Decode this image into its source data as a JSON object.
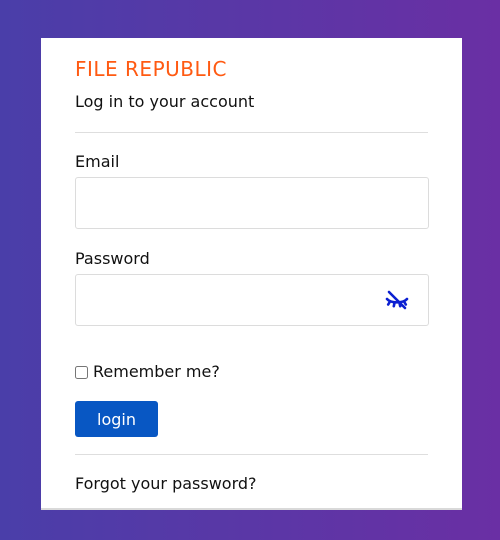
{
  "brand": {
    "name": "FILE REPUBLIC",
    "color": "#ff5a12"
  },
  "form": {
    "subtitle": "Log in to your account",
    "email": {
      "label": "Email",
      "value": "",
      "placeholder": ""
    },
    "password": {
      "label": "Password",
      "value": "",
      "placeholder": "",
      "toggle_icon": "eye-slash-icon"
    },
    "remember": {
      "label": "Remember me?",
      "checked": false
    },
    "login_button": "login",
    "forgot_link": "Forgot your password?"
  },
  "colors": {
    "accent": "#0857c3",
    "background_start": "#4a3ea9",
    "background_end": "#6a2fa4"
  }
}
